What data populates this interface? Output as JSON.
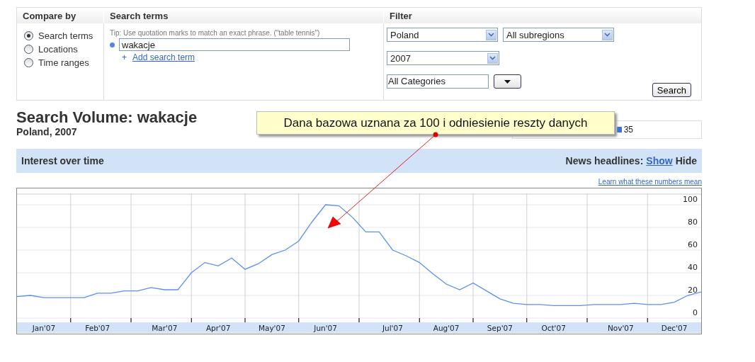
{
  "compare_by": {
    "title": "Compare by",
    "options": [
      {
        "label": "Search terms",
        "selected": true
      },
      {
        "label": "Locations",
        "selected": false
      },
      {
        "label": "Time ranges",
        "selected": false
      }
    ]
  },
  "search_terms": {
    "title": "Search terms",
    "tip": "Tip: Use quotation marks to match an exact phrase. (\"table tennis\")",
    "terms": [
      {
        "value": "wakacje",
        "color": "#4f86e8"
      }
    ],
    "add_icon": "+",
    "add_link": "Add search term"
  },
  "filter": {
    "title": "Filter",
    "select_rows": [
      [
        {
          "value": "Poland"
        },
        {
          "value": "All subregions"
        }
      ],
      [
        {
          "value": "2007"
        }
      ]
    ],
    "category": "All Categories",
    "search_button": "Search"
  },
  "result": {
    "title": "Search Volume: wakacje",
    "subtitle": "Poland, 2007",
    "legend_value": "35"
  },
  "callout": {
    "text": "Dana bazowa uznana za 100 i odniesienie reszty danych"
  },
  "interest_bar": {
    "title": "Interest over time",
    "news_label": "News headlines:",
    "news_toggle": [
      {
        "label": "Show",
        "selected": false
      },
      {
        "label": "Hide",
        "selected": true
      }
    ]
  },
  "learn_link": "Learn what these numbers mean",
  "chart": {
    "chart_data": {
      "type": "line",
      "ylim": [
        0,
        110
      ],
      "yticks": [
        0,
        20,
        40,
        60,
        80,
        100
      ],
      "grid": true,
      "categories": [
        null,
        null,
        "Jan'07",
        null,
        null,
        null,
        "Feb'07",
        null,
        null,
        null,
        null,
        "Mar'07",
        null,
        null,
        null,
        "Apr'07",
        null,
        null,
        null,
        "May'07",
        null,
        null,
        null,
        "Jun'07",
        null,
        null,
        null,
        null,
        "Jul'07",
        null,
        null,
        null,
        "Aug'07",
        null,
        null,
        null,
        "Sep'07",
        null,
        null,
        null,
        "Oct'07",
        null,
        null,
        null,
        null,
        "Nov'07",
        null,
        null,
        null,
        "Dec'07",
        null,
        null
      ],
      "series": [
        {
          "color": "#5b8ff0",
          "values": [
            19,
            20,
            18,
            18,
            18,
            18,
            22,
            22,
            24,
            24,
            27,
            25,
            25,
            40,
            49,
            46,
            53,
            43,
            48,
            56,
            60,
            68,
            85,
            100,
            99,
            89,
            76,
            76,
            60,
            55,
            49,
            39,
            30,
            25,
            31,
            24,
            17,
            13,
            12,
            12,
            11,
            11,
            11,
            12,
            12,
            12,
            13,
            12,
            12,
            14,
            20,
            23
          ]
        }
      ]
    }
  }
}
